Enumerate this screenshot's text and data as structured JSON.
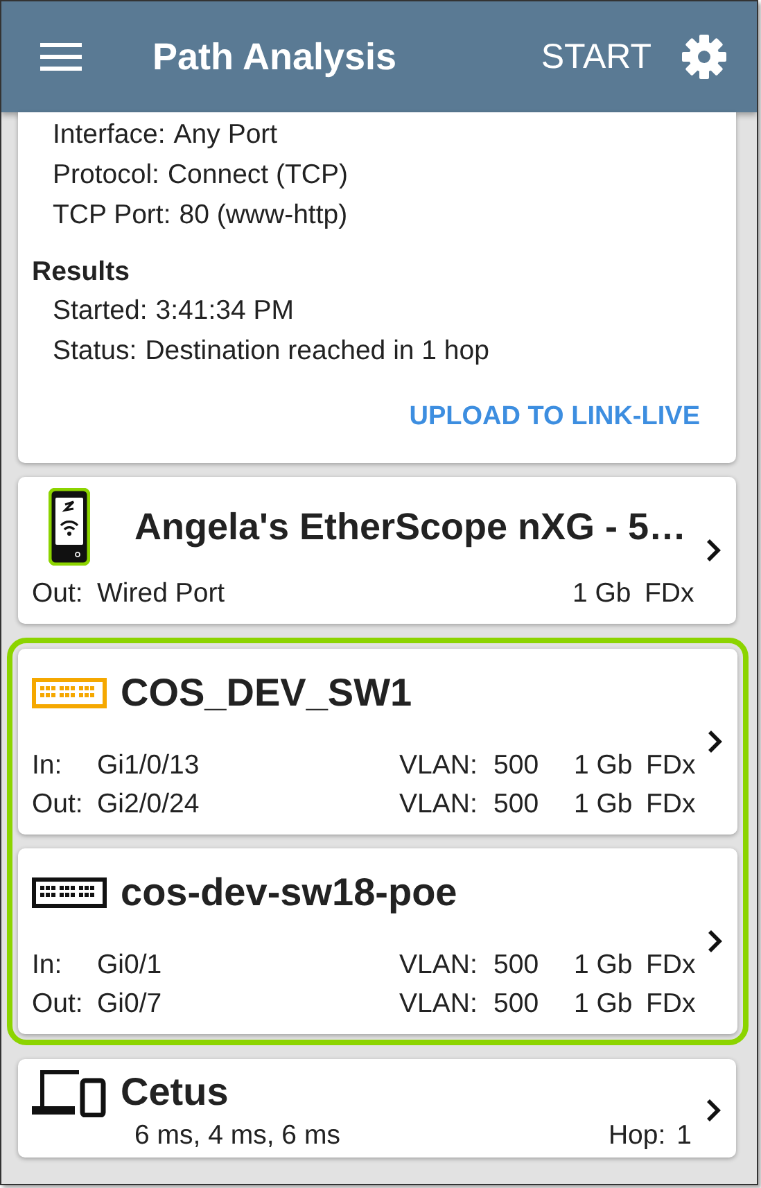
{
  "app_bar": {
    "title": "Path Analysis",
    "action": "START"
  },
  "summary": {
    "settings": [
      {
        "label": "Interface:",
        "value": "Any Port"
      },
      {
        "label": "Protocol:",
        "value": "Connect (TCP)"
      },
      {
        "label": "TCP Port:",
        "value": "80 (www-http)"
      }
    ],
    "results_heading": "Results",
    "results": [
      {
        "label": "Started:",
        "value": "3:41:34 PM"
      },
      {
        "label": "Status:",
        "value": "Destination reached in 1 hop"
      }
    ],
    "upload": "UPLOAD TO LINK-LIVE"
  },
  "hops": [
    {
      "kind": "analyzer",
      "name": "Angela's EtherScope nXG - 5…",
      "highlighted": false,
      "ports": [
        {
          "label": "Out:",
          "port": "Wired Port",
          "speed": "1 Gb",
          "duplex": "FDx"
        }
      ]
    },
    {
      "kind": "switch",
      "color": "#f5a800",
      "name": "COS_DEV_SW1",
      "highlighted": true,
      "ports": [
        {
          "label": "In:",
          "port": "Gi1/0/13",
          "vlan_label": "VLAN:",
          "vlan": "500",
          "speed": "1 Gb",
          "duplex": "FDx"
        },
        {
          "label": "Out:",
          "port": "Gi2/0/24",
          "vlan_label": "VLAN:",
          "vlan": "500",
          "speed": "1 Gb",
          "duplex": "FDx"
        }
      ]
    },
    {
      "kind": "switch",
      "color": "#111111",
      "name": "cos-dev-sw18-poe",
      "highlighted": true,
      "ports": [
        {
          "label": "In:",
          "port": "Gi0/1",
          "vlan_label": "VLAN:",
          "vlan": "500",
          "speed": "1 Gb",
          "duplex": "FDx"
        },
        {
          "label": "Out:",
          "port": "Gi0/7",
          "vlan_label": "VLAN:",
          "vlan": "500",
          "speed": "1 Gb",
          "duplex": "FDx"
        }
      ]
    },
    {
      "kind": "client",
      "name": "Cetus",
      "highlighted": false,
      "latency": "6 ms,  4 ms,  6 ms",
      "hop_label": "Hop:",
      "hop": "1"
    }
  ]
}
